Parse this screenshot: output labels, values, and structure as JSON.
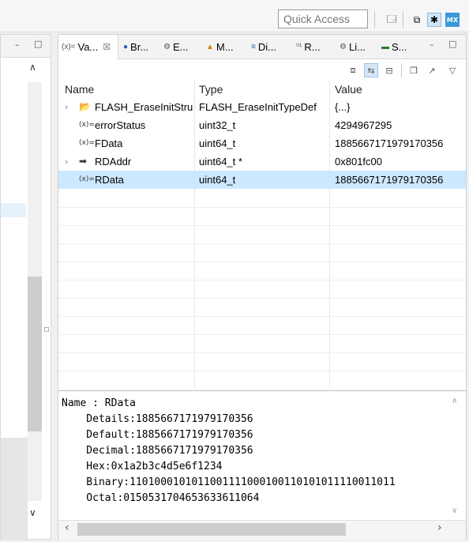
{
  "toolbar": {
    "quick_access_placeholder": "Quick Access",
    "mx_label": "MX"
  },
  "tabs": [
    {
      "label": "Va...",
      "icon": "(x)="
    },
    {
      "label": "Br...",
      "icon": "●"
    },
    {
      "label": "E...",
      "icon": "⚙"
    },
    {
      "label": "M...",
      "icon": "▲"
    },
    {
      "label": "Di...",
      "icon": "≡"
    },
    {
      "label": "R...",
      "icon": "⁰¹"
    },
    {
      "label": "Li...",
      "icon": "⚙"
    },
    {
      "label": "S...",
      "icon": "▬"
    }
  ],
  "table": {
    "columns": [
      "Name",
      "Type",
      "Value"
    ],
    "rows": [
      {
        "name": "FLASH_EraseInitStru",
        "type": "FLASH_EraseInitTypeDef",
        "value": "{...}",
        "icon": "struct-icon",
        "expandable": true,
        "selected": false
      },
      {
        "name": "errorStatus",
        "type": "uint32_t",
        "value": "4294967295",
        "icon": "variable-icon",
        "expandable": false,
        "selected": false
      },
      {
        "name": "FData",
        "type": "uint64_t",
        "value": "1885667171979170356",
        "icon": "variable-icon",
        "expandable": false,
        "selected": false
      },
      {
        "name": "RDAddr",
        "type": "uint64_t *",
        "value": "0x801fc00",
        "icon": "pointer-icon",
        "expandable": true,
        "selected": false
      },
      {
        "name": "RData",
        "type": "uint64_t",
        "value": "1885667171979170356",
        "icon": "variable-icon",
        "expandable": false,
        "selected": true
      }
    ]
  },
  "detail": {
    "lines": [
      "Name : RData",
      "    Details:1885667171979170356",
      "    Default:1885667171979170356",
      "    Decimal:1885667171979170356",
      "    Hex:0x1a2b3c4d5e6f1234",
      "    Binary:1101000101011001111000100110101011110011011",
      "    Octal:0150531704653633611064"
    ]
  }
}
